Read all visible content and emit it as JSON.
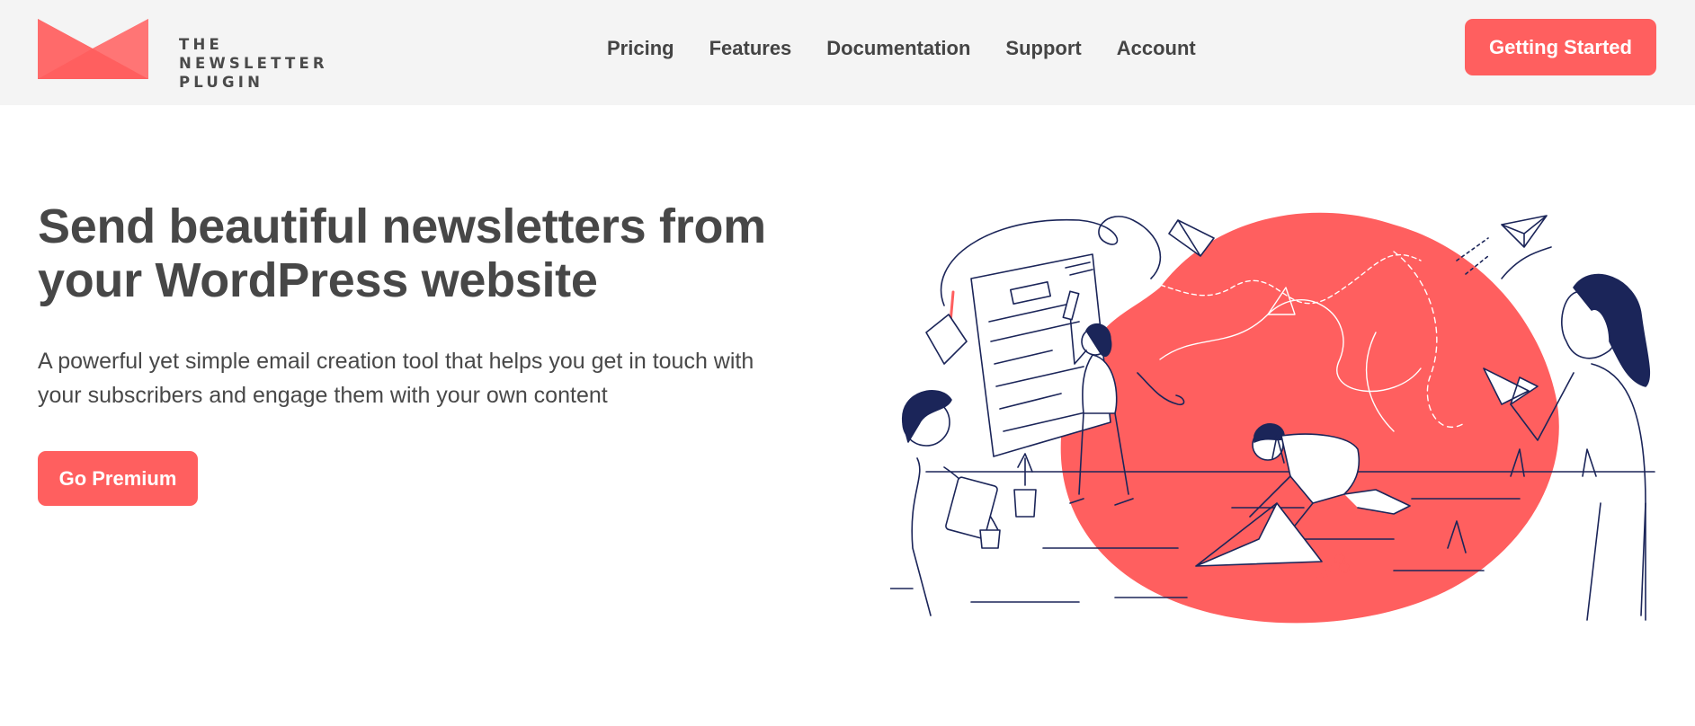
{
  "brand": {
    "name_line1": "THE NEWSLETTER",
    "name_line2": "PLUGIN",
    "accent_color": "#ff5f5f",
    "logo_icon": "envelope-logo-icon"
  },
  "nav": {
    "items": [
      {
        "label": "Pricing"
      },
      {
        "label": "Features"
      },
      {
        "label": "Documentation"
      },
      {
        "label": "Support"
      },
      {
        "label": "Account"
      }
    ],
    "cta_label": "Getting Started"
  },
  "hero": {
    "title_line1": "Send beautiful newsletters from",
    "title_line2": "your WordPress website",
    "subtitle_line1": "A powerful yet simple email creation tool that helps you get in touch with",
    "subtitle_line2": "your subscribers and engage them with your own content",
    "cta_label": "Go Premium",
    "illustration": "team-creating-newsletter-illustration",
    "ink_color": "#1b2559",
    "blob_color": "#ff5f5f"
  }
}
